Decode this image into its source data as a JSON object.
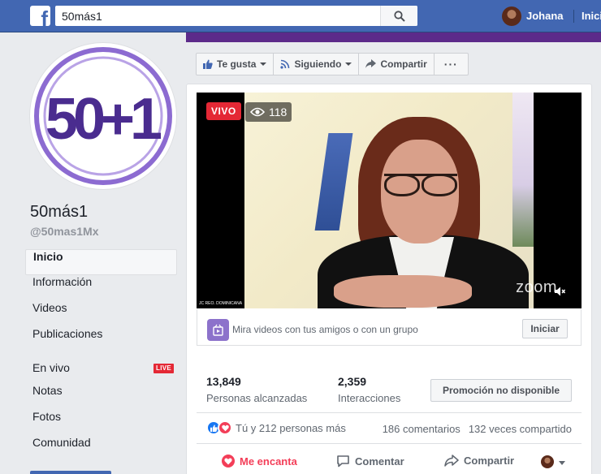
{
  "topbar": {
    "search_value": "50más1",
    "user_name": "Johana",
    "home_label": "Inicio"
  },
  "page": {
    "logo_text": "50+1",
    "name": "50más1",
    "handle": "@50mas1Mx"
  },
  "nav": {
    "items": [
      {
        "label": "Inicio",
        "active": true
      },
      {
        "label": "Información"
      },
      {
        "label": "Videos"
      },
      {
        "label": "Publicaciones"
      },
      {
        "label": "En vivo",
        "badge": "LIVE"
      },
      {
        "label": "Notas"
      },
      {
        "label": "Fotos"
      },
      {
        "label": "Comunidad"
      }
    ]
  },
  "actions": {
    "like_label": "Te gusta",
    "following_label": "Siguiendo",
    "share_label": "Compartir",
    "more_label": "···"
  },
  "video": {
    "live_label": "VIVO",
    "viewers": "118",
    "corner_caption": "JC REO. DOMINICANA",
    "watermark": "zoom"
  },
  "watch": {
    "text": "Mira videos con tus amigos o con un grupo",
    "button": "Iniciar"
  },
  "stats": {
    "reach_value": "13,849",
    "reach_label": "Personas alcanzadas",
    "interactions_value": "2,359",
    "interactions_label": "Interacciones",
    "promo_button": "Promoción no disponible"
  },
  "engagement": {
    "reactions_text": "Tú y 212 personas más",
    "comments": "186 comentarios",
    "shares": "132 veces compartido"
  },
  "bottom": {
    "love_label": "Me encanta",
    "comment_label": "Comentar",
    "share_label": "Compartir"
  },
  "colors": {
    "facebook_blue": "#4267b2",
    "brand_purple": "#5c2a8a",
    "live_red": "#e42835",
    "love_red": "#f33e58"
  }
}
